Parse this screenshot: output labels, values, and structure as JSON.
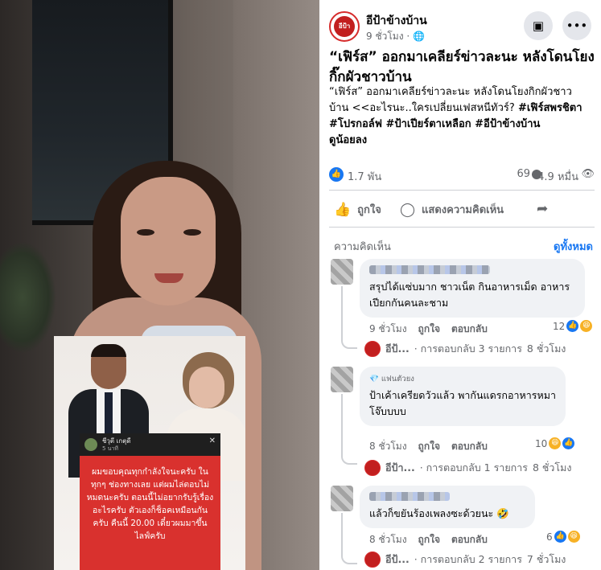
{
  "post": {
    "page_name": "อีป้าข้างบ้าน",
    "time": "9 ชั่วโมง",
    "privacy_icon": "globe-icon",
    "logo_text": "อีป้า",
    "title": "“เฟิร์ส” ออกมาเคลียร์ข่าวละนะ หลังโดนโยงกิ๊กผัวชาวบ้าน",
    "body_text": "“เฟิร์ส” ออกมาเคลียร์ข่าวละนะ หลังโดนโยงกิกผัวชาวบ้าน <<อะไรนะ..ใครเปลี่ยนเฟสหนีทัวร์?",
    "hashtags": "#เฟิร์สพรชิตา #โปรกอล์ฟ #ป้าเปียร์ตาเหลือก #อีป้าข้างบ้าน",
    "see_less": "ดูน้อยลง"
  },
  "stats": {
    "likes": "1.7 พัน",
    "comments": "69",
    "views": "4.9 หมื่น"
  },
  "actions": {
    "like": "ถูกใจ",
    "comment": "แสดงความคิดเห็น"
  },
  "comments_section": {
    "label": "ความคิดเห็น",
    "see_all": "ดูทั้งหมด"
  },
  "comments": [
    {
      "badge": "",
      "text": "สรุปได้แซ่บมาก ชาวเน็ต กินอาหารเม็ด อาหารเปียกกันคนละชาม",
      "time": "9 ชั่วโมง",
      "like": "ถูกใจ",
      "reply": "ตอบกลับ",
      "reactions": "12",
      "reply_page": "อีป้...",
      "reply_summary": "· การตอบกลับ 3 รายการ",
      "reply_time": "8 ชั่วโมง"
    },
    {
      "badge": "แฟนตัวยง",
      "text": "ป้าเค้าเครียดวัวแล้ว พากันแดรกอาหารหมา โจ๊บบบบ",
      "time": "8 ชั่วโมง",
      "like": "ถูกใจ",
      "reply": "ตอบกลับ",
      "reactions": "10",
      "reply_page": "อีป้า...",
      "reply_summary": "· การตอบกลับ 1 รายการ",
      "reply_time": "8 ชั่วโมง"
    },
    {
      "badge": "",
      "text": "แล้วก็ขยันร้องเพลงซะด้วยนะ 🤣",
      "time": "8 ชั่วโมง",
      "like": "ถูกใจ",
      "reply": "ตอบกลับ",
      "reactions": "6",
      "reply_page": "อีป้...",
      "reply_summary": "· การตอบกลับ 2 รายการ",
      "reply_time": "7 ชั่วโมง"
    }
  ],
  "media": {
    "story_name": "ชีวุตี เกตุดี",
    "story_time": "5 นาที",
    "story_text": "ผมขอบคุณทุกกำลังใจนะครับ ในทุกๆ ช่องทางเลย แต่ผมไล่ตอบไม่หมดนะครับ ตอนนี้ไม่อยากรับรู้เรื่องอะไรครับ ตัวเองก็ช็อคเหมือนกันครับ คืนนี้ 20.00 เดี๋ยวผมมาขึ้นไลฟ์ครับ"
  },
  "colors": {
    "accent": "#1877f2",
    "story_bg": "#d9312e",
    "muted": "#65676b"
  }
}
